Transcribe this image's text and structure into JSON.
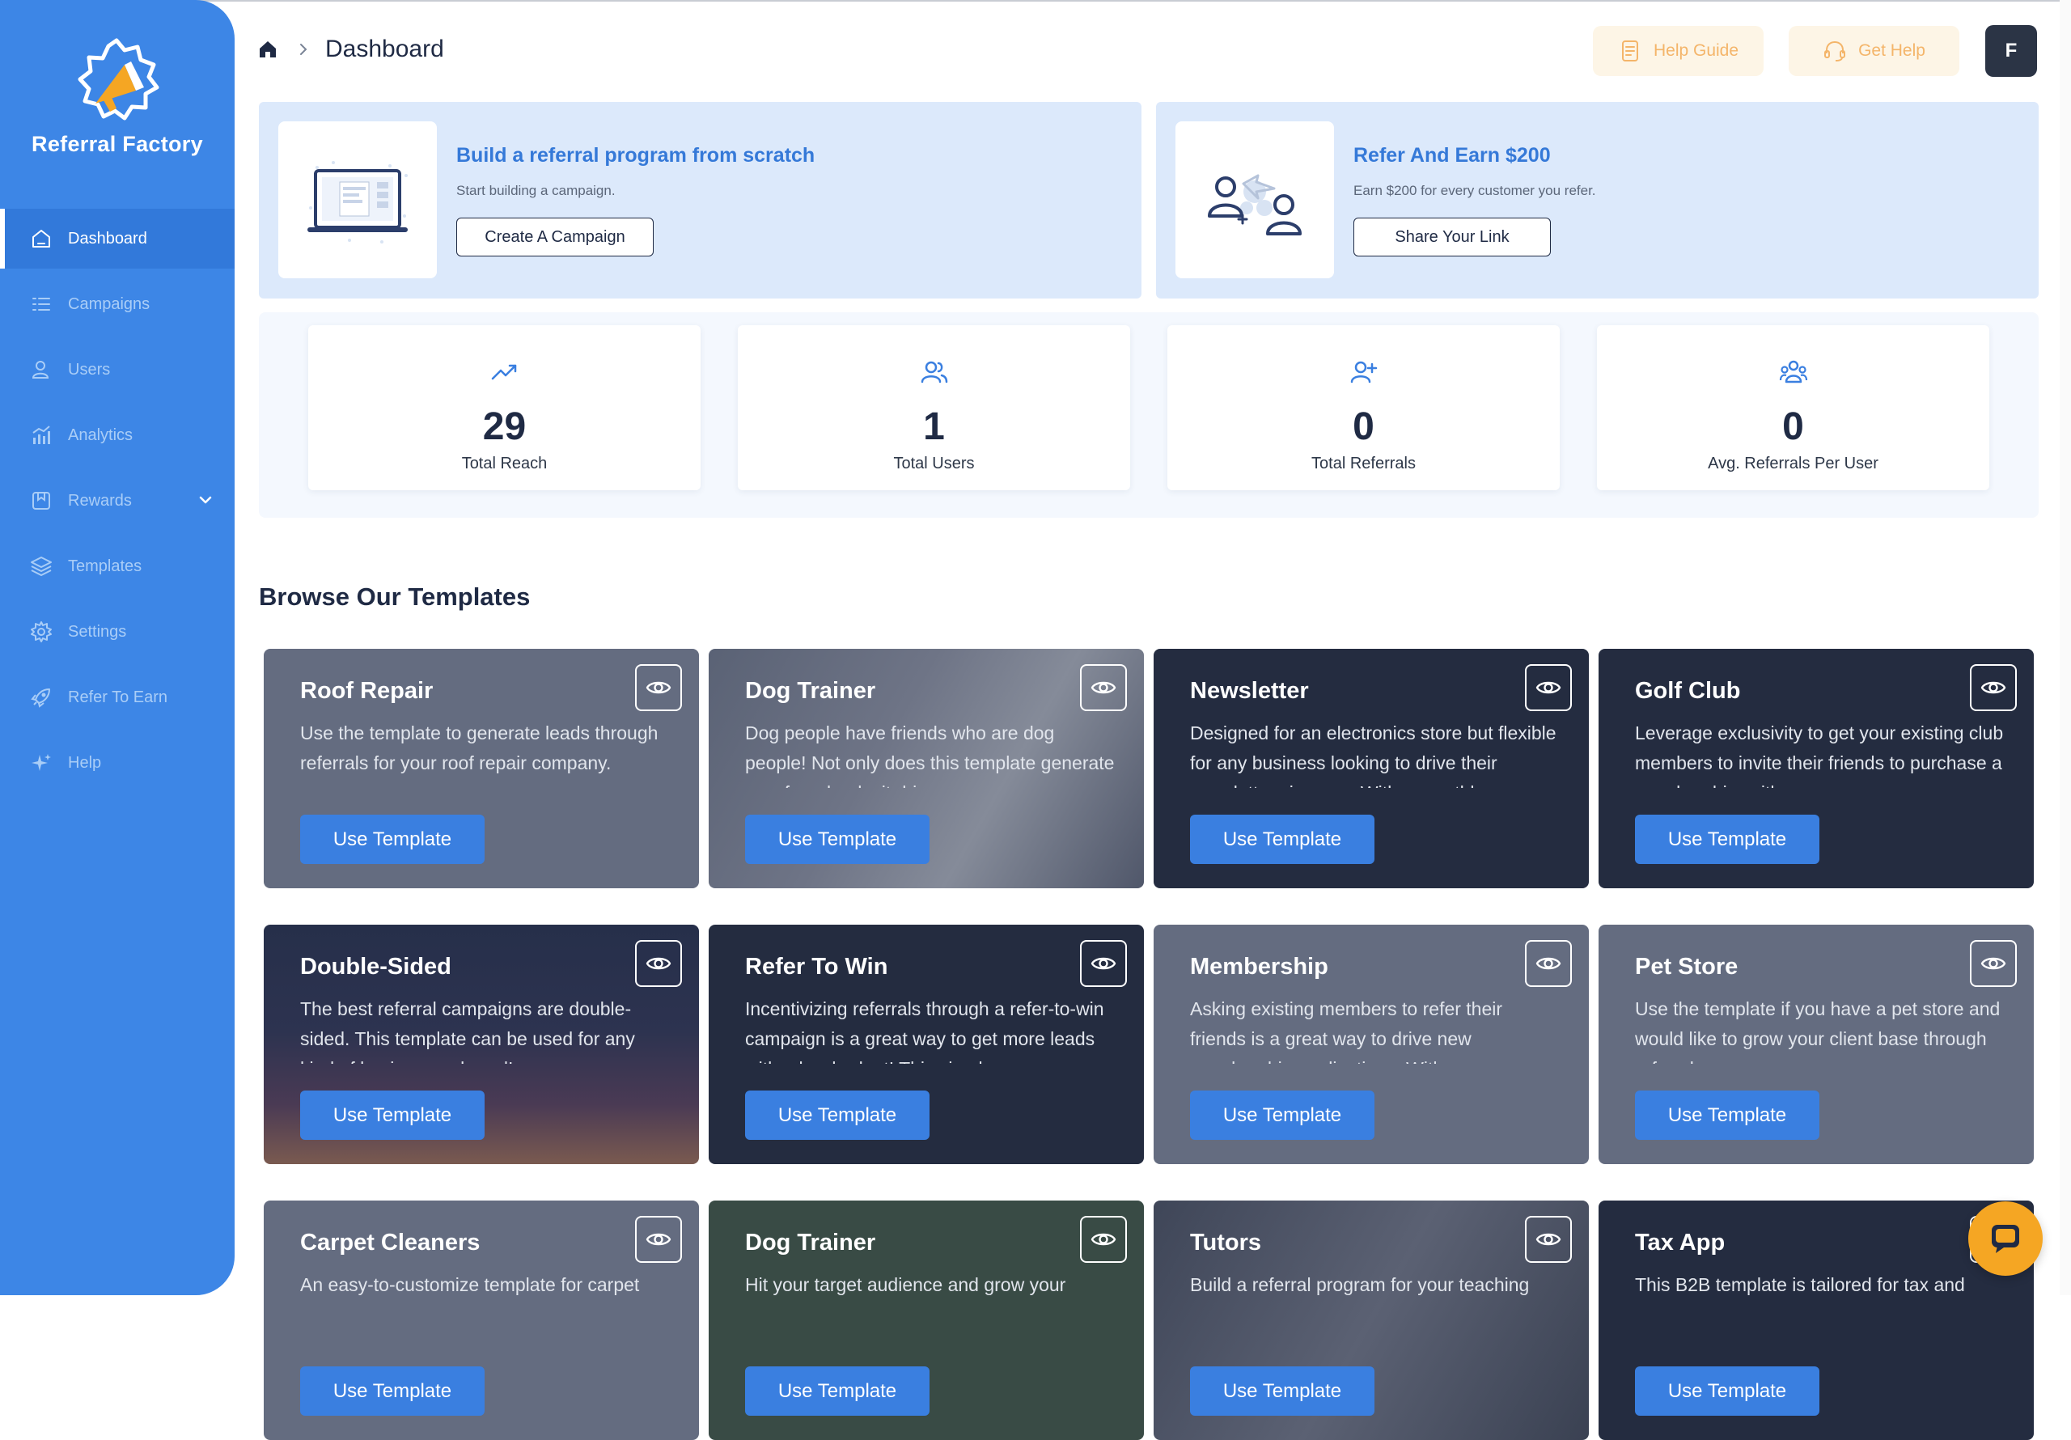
{
  "brand": {
    "name": "Referral Factory"
  },
  "colors": {
    "sidebar": "#3d86e6",
    "accent": "#3a7fe0",
    "help": "#f4b56a",
    "dark_card": "#242c40",
    "grey_card": "#646c80"
  },
  "sidebar": {
    "items": [
      {
        "label": "Dashboard",
        "icon": "home-icon",
        "active": true
      },
      {
        "label": "Campaigns",
        "icon": "list-icon"
      },
      {
        "label": "Users",
        "icon": "users-icon"
      },
      {
        "label": "Analytics",
        "icon": "chart-icon"
      },
      {
        "label": "Rewards",
        "icon": "gift-icon",
        "has_chevron": true
      },
      {
        "label": "Templates",
        "icon": "layers-icon"
      },
      {
        "label": "Settings",
        "icon": "gear-icon"
      },
      {
        "label": "Refer To Earn",
        "icon": "rocket-icon"
      },
      {
        "label": "Help",
        "icon": "sparkle-icon"
      }
    ]
  },
  "header": {
    "breadcrumb_title": "Dashboard",
    "help_guide": "Help Guide",
    "get_help": "Get Help",
    "avatar_initial": "F"
  },
  "promos": [
    {
      "title": "Build a referral program from scratch",
      "subtitle": "Start building a campaign.",
      "button": "Create A Campaign"
    },
    {
      "title": "Refer And Earn $200",
      "subtitle": "Earn $200 for every customer you refer.",
      "button": "Share Your Link"
    }
  ],
  "stats": [
    {
      "value": "29",
      "label": "Total Reach",
      "icon": "trend-up-icon"
    },
    {
      "value": "1",
      "label": "Total Users",
      "icon": "users-icon"
    },
    {
      "value": "0",
      "label": "Total Referrals",
      "icon": "user-plus-icon"
    },
    {
      "value": "0",
      "label": "Avg. Referrals Per User",
      "icon": "user-group-icon"
    }
  ],
  "templates_section": {
    "title": "Browse Our Templates",
    "use_label": "Use Template"
  },
  "templates": [
    {
      "title": "Roof Repair",
      "description": "Use the template to generate leads through referrals for your roof repair company.",
      "style": "grey"
    },
    {
      "title": "Dog Trainer",
      "description": "Dog people have friends who are dog people! Not only does this template generate new furry leads, it drives...",
      "style": "photo"
    },
    {
      "title": "Newsletter",
      "description": "Designed for an electronics store but flexible for any business looking to drive their newsletter sign-ups. With a monthl...",
      "style": "dark"
    },
    {
      "title": "Golf Club",
      "description": "Leverage exclusivity to get your existing club members to invite their friends to purchase a membership, with an...",
      "style": "dark"
    },
    {
      "title": "Double-Sided",
      "description": "The best referral campaigns are double-sided. This template can be used for any kind of business or brand!",
      "style": "sunset"
    },
    {
      "title": "Refer To Win",
      "description": "Incentivizing referrals through a refer-to-win campaign is a great way to get more leads with a low budget! This simple...",
      "style": "dark"
    },
    {
      "title": "Membership",
      "description": "Asking existing members to refer their friends is a great way to drive new membership applications. With an...",
      "style": "grey"
    },
    {
      "title": "Pet Store",
      "description": "Use the template if you have a pet store and would like to grow your client base through referrals.",
      "style": "grey"
    },
    {
      "title": "Carpet Cleaners",
      "description": "An easy-to-customize template for carpet",
      "style": "grey"
    },
    {
      "title": "Dog Trainer",
      "description": "Hit your target audience and grow your",
      "style": "green"
    },
    {
      "title": "Tutors",
      "description": "Build a referral program for your teaching",
      "style": "photo2"
    },
    {
      "title": "Tax App",
      "description": "This B2B template is tailored for tax and",
      "style": "dark"
    }
  ]
}
